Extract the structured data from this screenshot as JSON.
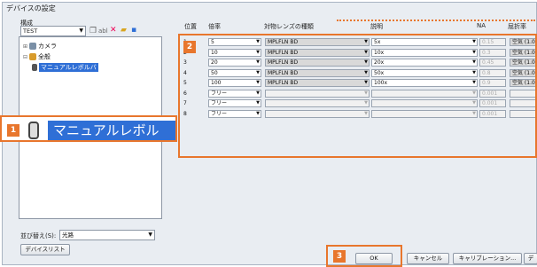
{
  "window": {
    "title": "デバイスの設定"
  },
  "left": {
    "config_label": "構成",
    "config_value": "TEST",
    "toolbar": [
      "abl"
    ],
    "tree": [
      {
        "label": "カメラ",
        "icon": "camera-icon"
      },
      {
        "label": "全般",
        "icon": "gear-icon"
      },
      {
        "label": "マニュアルレボルバ",
        "icon": "revolver-icon",
        "selected": true
      }
    ],
    "sort_label": "並び替え(S):",
    "sort_value": "光路",
    "device_list_button": "デバイスリスト"
  },
  "callout": {
    "badge": "1",
    "text": "マニュアルレボルバ"
  },
  "grid": {
    "badge": "2",
    "headers": [
      "位置",
      "倍率",
      "対物レンズの種類",
      "説明",
      "NA",
      "屈折率"
    ],
    "rows": [
      {
        "pos": "1",
        "mag": "5",
        "type": "MPLFLN BD",
        "desc": "5x",
        "na": "0.15",
        "ri": "空気 (1.0"
      },
      {
        "pos": "2",
        "mag": "10",
        "type": "MPLFLN BD",
        "desc": "10x",
        "na": "0.3",
        "ri": "空気 (1.0"
      },
      {
        "pos": "3",
        "mag": "20",
        "type": "MPLFLN BD",
        "desc": "20x",
        "na": "0.45",
        "ri": "空気 (1.0"
      },
      {
        "pos": "4",
        "mag": "50",
        "type": "MPLFLN BD",
        "desc": "50x",
        "na": "0.8",
        "ri": "空気 (1.0"
      },
      {
        "pos": "5",
        "mag": "100",
        "type": "MPLFLN BD",
        "desc": "100x",
        "na": "0.9",
        "ri": "空気 (1.0"
      },
      {
        "pos": "6",
        "mag": "フリー",
        "type": "",
        "desc": "",
        "na": "0.001",
        "ri": ""
      },
      {
        "pos": "7",
        "mag": "フリー",
        "type": "",
        "desc": "",
        "na": "0.001",
        "ri": ""
      },
      {
        "pos": "8",
        "mag": "フリー",
        "type": "",
        "desc": "",
        "na": "0.001",
        "ri": ""
      }
    ]
  },
  "footer": {
    "badge": "3",
    "ok": "OK",
    "cancel": "キャンセル",
    "calibration": "キャリブレーション...",
    "extra": "デ"
  },
  "colors": {
    "accent": "#e8762d",
    "selection": "#2f6fd6"
  }
}
